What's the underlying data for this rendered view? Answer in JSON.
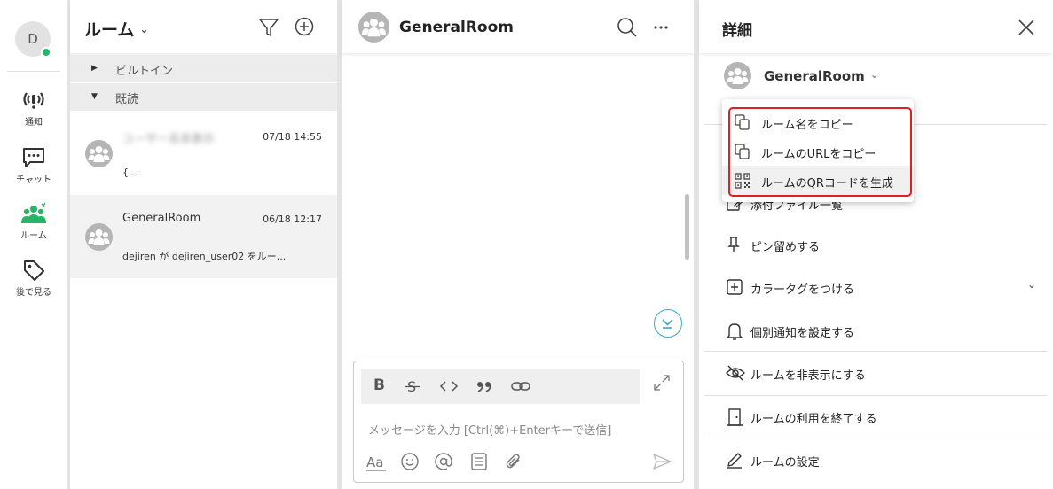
{
  "nav": {
    "avatar_initial": "D",
    "items": [
      {
        "label": "通知",
        "icon": "notification-icon"
      },
      {
        "label": "チャット",
        "icon": "chat-icon"
      },
      {
        "label": "ルーム",
        "icon": "room-icon",
        "active": true
      },
      {
        "label": "後で見る",
        "icon": "tag-icon"
      }
    ]
  },
  "rooms": {
    "title": "ルーム",
    "sections": [
      {
        "label": "ビルトイン",
        "collapsed": true
      },
      {
        "label": "既読",
        "collapsed": false
      }
    ],
    "list": [
      {
        "name": "ユーザー名非表示",
        "time": "07/18 14:55",
        "last_message": "{..."
      },
      {
        "name": "GeneralRoom",
        "time": "06/18 12:17",
        "last_message": "dejiren が dejiren_user02 をルー..."
      }
    ]
  },
  "chat": {
    "title": "GeneralRoom",
    "composer_placeholder": "メッセージを入力 [Ctrl(⌘)+Enterキーで送信]",
    "formatting": {
      "bold": "B",
      "strike": "S",
      "code": "<>",
      "quote": "99",
      "link": "link-icon"
    }
  },
  "detail": {
    "title": "詳細",
    "room_name": "GeneralRoom",
    "menu": [
      {
        "label": "添付ファイル一覧",
        "icon": "attachment-list-icon"
      },
      {
        "label": "ピン留めする",
        "icon": "pin-icon"
      },
      {
        "label": "カラータグをつける",
        "icon": "plus-square-icon"
      },
      {
        "label": "個別通知を設定する",
        "icon": "bell-icon"
      },
      {
        "label": "ルームを非表示にする",
        "icon": "eye-off-icon"
      },
      {
        "label": "ルームの利用を終了する",
        "icon": "door-icon"
      },
      {
        "label": "ルームの設定",
        "icon": "pencil-icon"
      }
    ]
  },
  "dropdown": {
    "items": [
      {
        "label": "ルーム名をコピー",
        "icon": "copy-icon"
      },
      {
        "label": "ルームのURLをコピー",
        "icon": "copy-icon"
      },
      {
        "label": "ルームのQRコードを生成",
        "icon": "qr-code-icon"
      }
    ]
  },
  "colors": {
    "accent": "#26b567",
    "highlight": "#e02020",
    "scroll_button": "#3ba7c9"
  }
}
